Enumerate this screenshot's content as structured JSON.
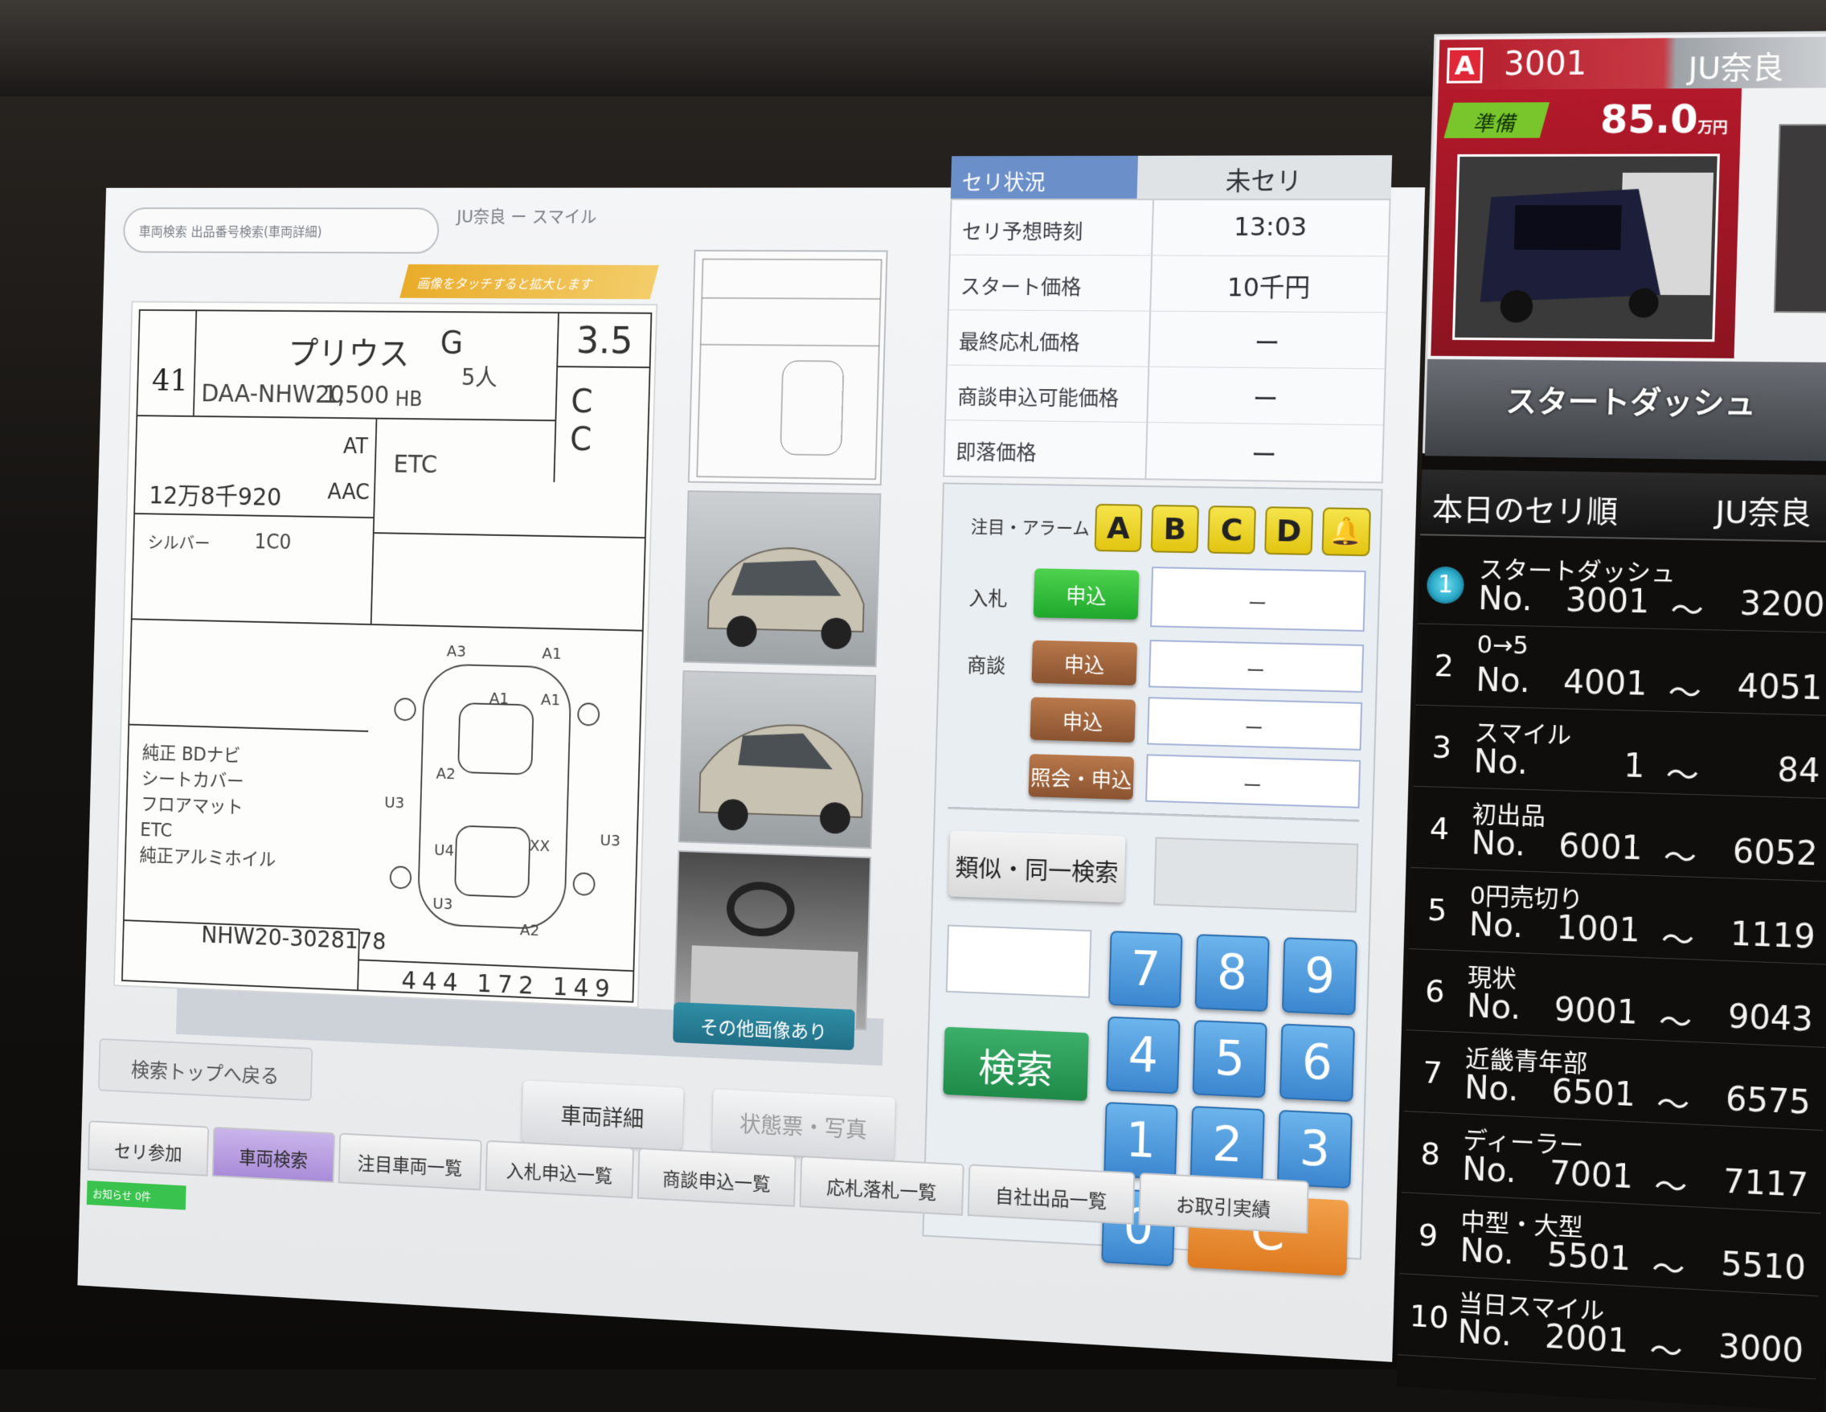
{
  "app": {
    "breadcrumb": "車両検索  出品番号検索(車両詳細)",
    "title": "JU奈良 ー スマイル",
    "touch_hint": "画像をタッチすると拡大します"
  },
  "sheet": {
    "lot_number": "41",
    "model_name": "プリウス",
    "grade": "G",
    "score": "3.5",
    "model_code": "DAA-NHW20",
    "displacement": "1,500",
    "body": "HB",
    "seats": "5人",
    "interior_exterior": "C C",
    "transmission": "AT",
    "aircon": "AAC",
    "mileage": "12万8千920",
    "sales_point": "ETC",
    "color": "シルバー",
    "color_code": "1C0",
    "chassis_no": "NHW20-3028178",
    "dimensions": "444 172 149",
    "notes": [
      "純正 BDナビ",
      "シートカバー",
      "フロアマット",
      "ETC",
      "純正アルミホイル"
    ],
    "diagram_marks": [
      "A3",
      "A1",
      "A1",
      "A1",
      "A2",
      "U3",
      "U3",
      "U4",
      "U3",
      "XX",
      "A2"
    ]
  },
  "more_images_label": "その他画像あり",
  "status": {
    "header": "セリ状況",
    "state": "未セリ",
    "rows": [
      {
        "label": "セリ予想時刻",
        "value": "13:03"
      },
      {
        "label": "スタート価格",
        "value": "10千円"
      },
      {
        "label": "最終応札価格",
        "value": "ー"
      },
      {
        "label": "商談申込可能価格",
        "value": "ー"
      },
      {
        "label": "即落価格",
        "value": "ー"
      }
    ]
  },
  "bid_panel": {
    "alarm_label": "注目・アラーム",
    "alarms": [
      "A",
      "B",
      "C",
      "D"
    ],
    "bid_label": "入札",
    "bid_button": "申込",
    "bid_value": "ー",
    "nego_label": "商談",
    "nego_button_1": "申込",
    "nego_value_1": "ー",
    "nego_button_2": "申込",
    "nego_value_2": "ー",
    "inquiry_button": "照会・申込",
    "inquiry_value": "ー",
    "similar_search": "類似・同一検索",
    "search_button": "検索",
    "keys": [
      "7",
      "8",
      "9",
      "4",
      "5",
      "6",
      "1",
      "2",
      "3",
      "0"
    ],
    "clear_key": "C"
  },
  "buttons": {
    "back": "検索トップへ戻る",
    "vehicle_detail": "車両詳細",
    "condition_photo": "状態票・写真"
  },
  "tabs": [
    {
      "label": "セリ参加",
      "active": false
    },
    {
      "label": "車両検索",
      "active": true
    },
    {
      "label": "注目車両一覧",
      "active": false
    },
    {
      "label": "入札申込一覧",
      "active": false
    },
    {
      "label": "商談申込一覧",
      "active": false
    },
    {
      "label": "応札落札一覧",
      "active": false
    },
    {
      "label": "自社出品一覧",
      "active": false
    },
    {
      "label": "お取引実績",
      "active": false
    }
  ],
  "notice": "お知らせ 0件",
  "current_lot": {
    "badge": "A",
    "lot_no": "3001",
    "venue": "JU奈良",
    "state": "準備",
    "price": "85.0",
    "price_unit": "万円",
    "name": "スタートダッシュ"
  },
  "order": {
    "title": "本日のセリ順",
    "venue": "JU奈良",
    "no_label": "No.",
    "items": [
      {
        "idx": "1",
        "name": "スタートダッシュ",
        "from": "3001",
        "to": "3200"
      },
      {
        "idx": "2",
        "name": "0→5",
        "from": "4001",
        "to": "4051"
      },
      {
        "idx": "3",
        "name": "スマイル",
        "from": "1",
        "to": "84"
      },
      {
        "idx": "4",
        "name": "初出品",
        "from": "6001",
        "to": "6052"
      },
      {
        "idx": "5",
        "name": "0円売切り",
        "from": "1001",
        "to": "1119"
      },
      {
        "idx": "6",
        "name": "現状",
        "from": "9001",
        "to": "9043"
      },
      {
        "idx": "7",
        "name": "近畿青年部",
        "from": "6501",
        "to": "6575"
      },
      {
        "idx": "8",
        "name": "ディーラー",
        "from": "7001",
        "to": "7117"
      },
      {
        "idx": "9",
        "name": "中型・大型",
        "from": "5501",
        "to": "5510"
      },
      {
        "idx": "10",
        "name": "当日スマイル",
        "from": "2001",
        "to": "3000"
      }
    ]
  },
  "colors": {
    "status_header": "#6b8fc8",
    "apply_green": "#1ea82c",
    "apply_brown": "#8a5330",
    "keypad_blue": "#3b86cf",
    "clear_orange": "#de7a20",
    "lot_red": "#b3192a",
    "tab_active": "#a98cd9"
  }
}
